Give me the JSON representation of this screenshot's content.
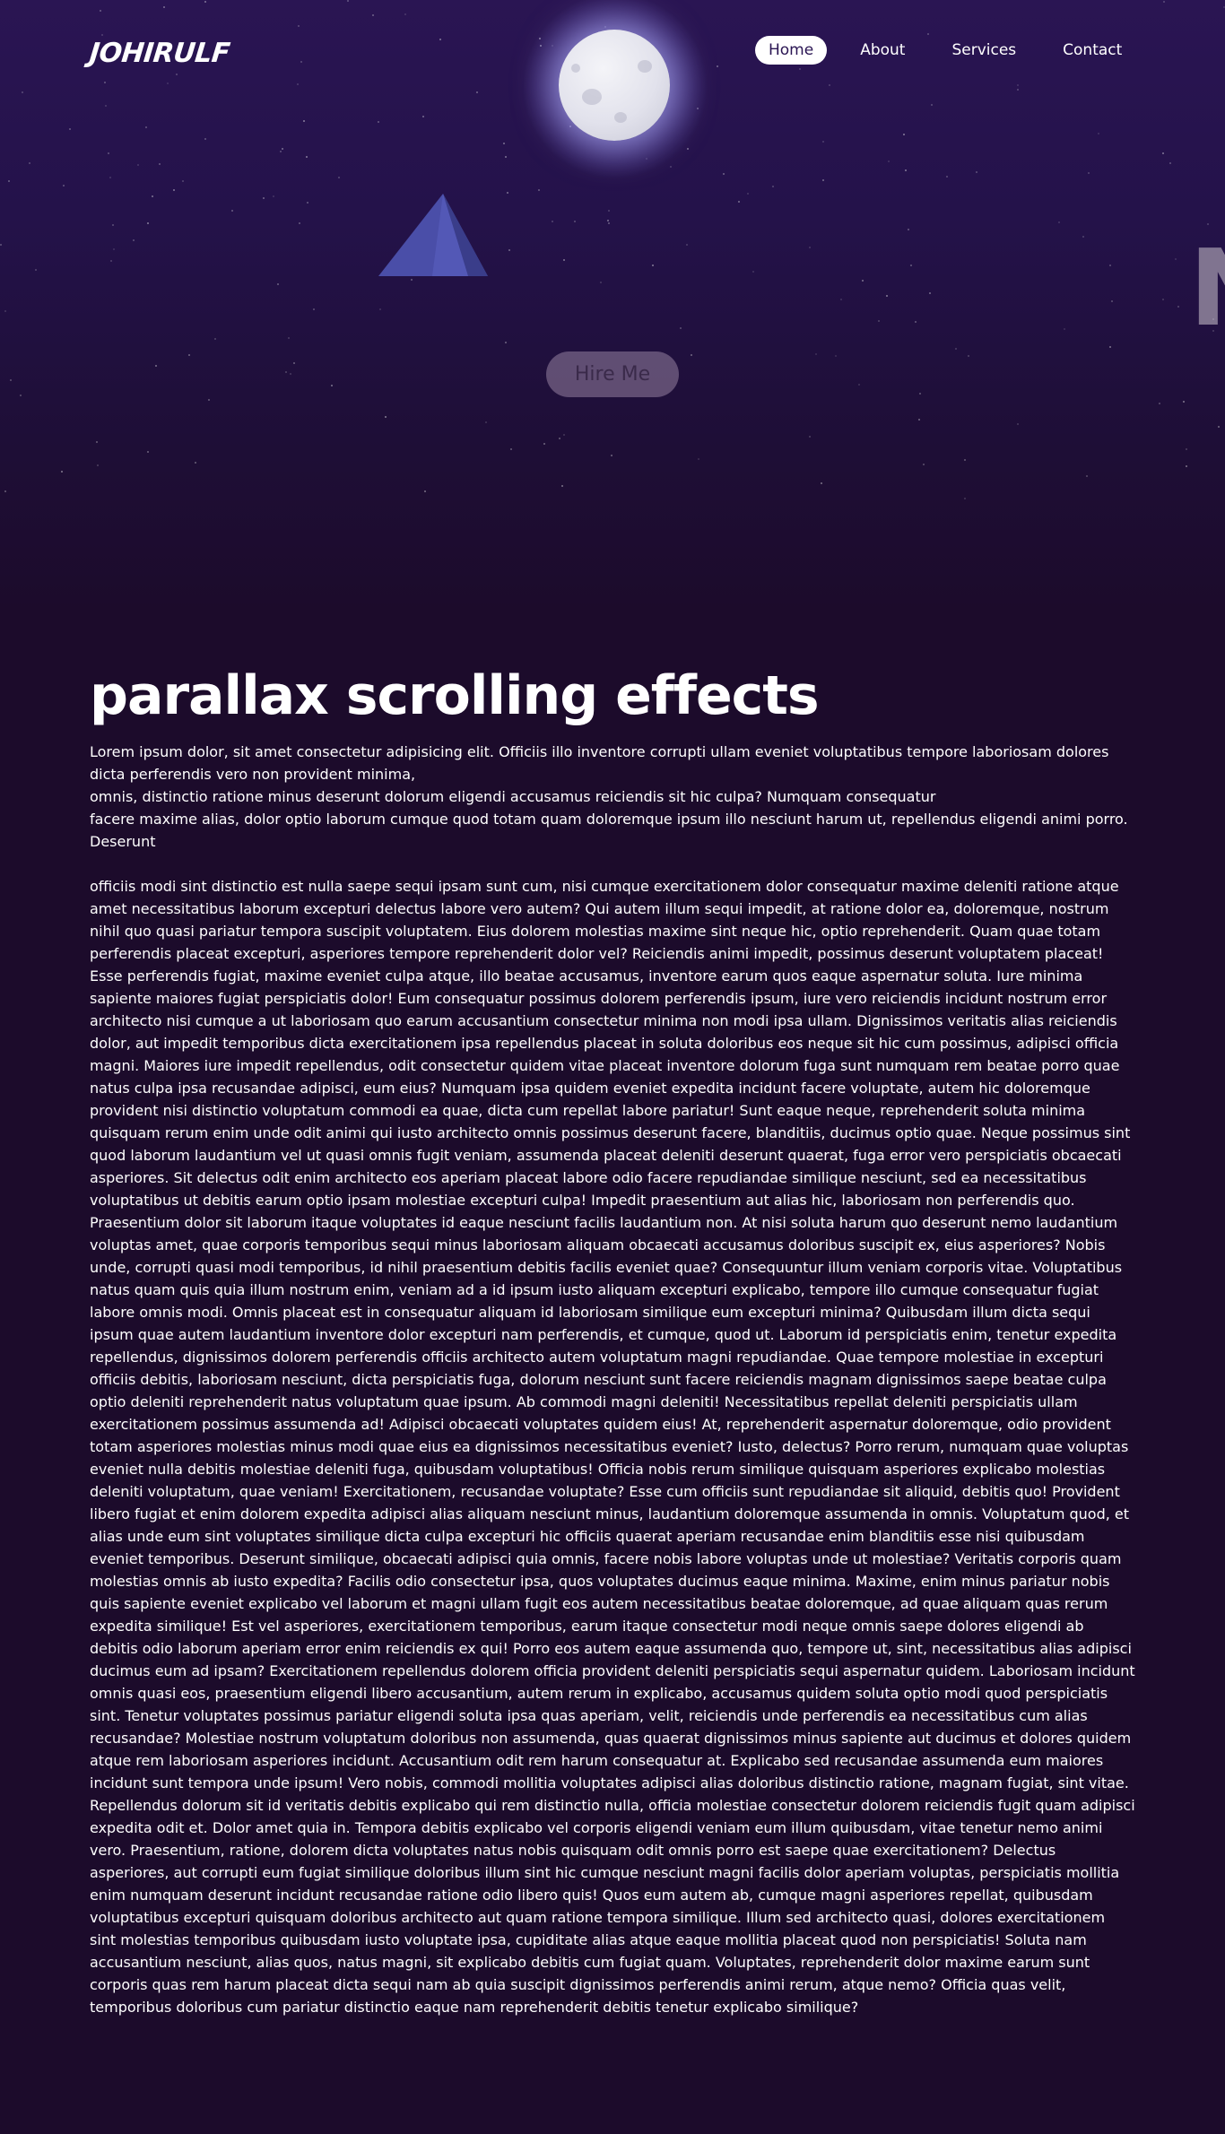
{
  "header": {
    "logo": "JOHIRULF",
    "nav": [
      {
        "label": "Home",
        "active": true
      },
      {
        "label": "About",
        "active": false
      },
      {
        "label": "Services",
        "active": false
      },
      {
        "label": "Contact",
        "active": false
      }
    ]
  },
  "hero": {
    "hire_button": "Hire Me",
    "side_letter": "N"
  },
  "main": {
    "title": "parallax scrolling effects",
    "intro_lines": [
      "Lorem ipsum dolor, sit amet consectetur adipisicing elit. Officiis illo inventore corrupti ullam eveniet voluptatibus tempore laboriosam dolores dicta perferendis vero non provident minima,",
      "omnis, distinctio ratione minus deserunt dolorum eligendi accusamus reiciendis sit hic culpa? Numquam consequatur",
      "facere maxime alias, dolor optio laborum cumque quod totam quam doloremque ipsum illo nesciunt harum ut, repellendus eligendi animi porro. Deserunt"
    ],
    "body_text": "officiis modi sint distinctio est nulla saepe sequi ipsam sunt cum, nisi cumque exercitationem dolor consequatur maxime deleniti ratione atque amet necessitatibus laborum excepturi delectus labore vero autem? Qui autem illum sequi impedit, at ratione dolor ea, doloremque, nostrum nihil quo quasi pariatur tempora suscipit voluptatem. Eius dolorem molestias maxime sint neque hic, optio reprehenderit. Quam quae totam perferendis placeat excepturi, asperiores tempore reprehenderit dolor vel? Reiciendis animi impedit, possimus deserunt voluptatem placeat! Esse perferendis fugiat, maxime eveniet culpa atque, illo beatae accusamus, inventore earum quos eaque aspernatur soluta. Iure minima sapiente maiores fugiat perspiciatis dolor! Eum consequatur possimus dolorem perferendis ipsum, iure vero reiciendis incidunt nostrum error architecto nisi cumque a ut laboriosam quo earum accusantium consectetur minima non modi ipsa ullam. Dignissimos veritatis alias reiciendis dolor, aut impedit temporibus dicta exercitationem ipsa repellendus placeat in soluta doloribus eos neque sit hic cum possimus, adipisci officia magni. Maiores iure impedit repellendus, odit consectetur quidem vitae placeat inventore dolorum fuga sunt numquam rem beatae porro quae natus culpa ipsa recusandae adipisci, eum eius? Numquam ipsa quidem eveniet expedita incidunt facere voluptate, autem hic doloremque provident nisi distinctio voluptatum commodi ea quae, dicta cum repellat labore pariatur! Sunt eaque neque, reprehenderit soluta minima quisquam rerum enim unde odit animi qui iusto architecto omnis possimus deserunt facere, blanditiis, ducimus optio quae. Neque possimus sint quod laborum laudantium vel ut quasi omnis fugit veniam, assumenda placeat deleniti deserunt quaerat, fuga error vero perspiciatis obcaecati asperiores. Sit delectus odit enim architecto eos aperiam placeat labore odio facere repudiandae similique nesciunt, sed ea necessitatibus voluptatibus ut debitis earum optio ipsam molestiae excepturi culpa! Impedit praesentium aut alias hic, laboriosam non perferendis quo. Praesentium dolor sit laborum itaque voluptates id eaque nesciunt facilis laudantium non. At nisi soluta harum quo deserunt nemo laudantium voluptas amet, quae corporis temporibus sequi minus laboriosam aliquam obcaecati accusamus doloribus suscipit ex, eius asperiores? Nobis unde, corrupti quasi modi temporibus, id nihil praesentium debitis facilis eveniet quae? Consequuntur illum veniam corporis vitae. Voluptatibus natus quam quis quia illum nostrum enim, veniam ad a id ipsum iusto aliquam excepturi explicabo, tempore illo cumque consequatur fugiat labore omnis modi. Omnis placeat est in consequatur aliquam id laboriosam similique eum excepturi minima? Quibusdam illum dicta sequi ipsum quae autem laudantium inventore dolor excepturi nam perferendis, et cumque, quod ut. Laborum id perspiciatis enim, tenetur expedita repellendus, dignissimos dolorem perferendis officiis architecto autem voluptatum magni repudiandae. Quae tempore molestiae in excepturi officiis debitis, laboriosam nesciunt, dicta perspiciatis fuga, dolorum nesciunt sunt facere reiciendis magnam dignissimos saepe beatae culpa optio deleniti reprehenderit natus voluptatum quae ipsum. Ab commodi magni deleniti! Necessitatibus repellat deleniti perspiciatis ullam exercitationem possimus assumenda ad! Adipisci obcaecati voluptates quidem eius! At, reprehenderit aspernatur doloremque, odio provident totam asperiores molestias minus modi quae eius ea dignissimos necessitatibus eveniet? Iusto, delectus? Porro rerum, numquam quae voluptas eveniet nulla debitis molestiae deleniti fuga, quibusdam voluptatibus! Officia nobis rerum similique quisquam asperiores explicabo molestias deleniti voluptatum, quae veniam! Exercitationem, recusandae voluptate? Esse cum officiis sunt repudiandae sit aliquid, debitis quo! Provident libero fugiat et enim dolorem expedita adipisci alias aliquam nesciunt minus, laudantium doloremque assumenda in omnis. Voluptatum quod, et alias unde eum sint voluptates similique dicta culpa excepturi hic officiis quaerat aperiam recusandae enim blanditiis esse nisi quibusdam eveniet temporibus. Deserunt similique, obcaecati adipisci quia omnis, facere nobis labore voluptas unde ut molestiae? Veritatis corporis quam molestias omnis ab iusto expedita? Facilis odio consectetur ipsa, quos voluptates ducimus eaque minima. Maxime, enim minus pariatur nobis quis sapiente eveniet explicabo vel laborum et magni ullam fugit eos autem necessitatibus beatae doloremque, ad quae aliquam quas rerum expedita similique! Est vel asperiores, exercitationem temporibus, earum itaque consectetur modi neque omnis saepe dolores eligendi ab debitis odio laborum aperiam error enim reiciendis ex qui! Porro eos autem eaque assumenda quo, tempore ut, sint, necessitatibus alias adipisci ducimus eum ad ipsam? Exercitationem repellendus dolorem officia provident deleniti perspiciatis sequi aspernatur quidem. Laboriosam incidunt omnis quasi eos, praesentium eligendi libero accusantium, autem rerum in explicabo, accusamus quidem soluta optio modi quod perspiciatis sint. Tenetur voluptates possimus pariatur eligendi soluta ipsa quas aperiam, velit, reiciendis unde perferendis ea necessitatibus cum alias recusandae? Molestiae nostrum voluptatum doloribus non assumenda, quas quaerat dignissimos minus sapiente aut ducimus et dolores quidem atque rem laboriosam asperiores incidunt. Accusantium odit rem harum consequatur at. Explicabo sed recusandae assumenda eum maiores incidunt sunt tempora unde ipsum! Vero nobis, commodi mollitia voluptates adipisci alias doloribus distinctio ratione, magnam fugiat, sint vitae. Repellendus dolorum sit id veritatis debitis explicabo qui rem distinctio nulla, officia molestiae consectetur dolorem reiciendis fugit quam adipisci expedita odit et. Dolor amet quia in. Tempora debitis explicabo vel corporis eligendi veniam eum illum quibusdam, vitae tenetur nemo animi vero. Praesentium, ratione, dolorem dicta voluptates natus nobis quisquam odit omnis porro est saepe quae exercitationem? Delectus asperiores, aut corrupti eum fugiat similique doloribus illum sint hic cumque nesciunt magni facilis dolor aperiam voluptas, perspiciatis mollitia enim numquam deserunt incidunt recusandae ratione odio libero quis! Quos eum autem ab, cumque magni asperiores repellat, quibusdam voluptatibus excepturi quisquam doloribus architecto aut quam ratione tempora similique. Illum sed architecto quasi, dolores exercitationem sint molestias temporibus quibusdam iusto voluptate ipsa, cupiditate alias atque eaque mollitia placeat quod non perspiciatis! Soluta nam accusantium nesciunt, alias quos, natus magni, sit explicabo debitis cum fugiat quam. Voluptates, reprehenderit dolor maxime earum sunt corporis quas rem harum placeat dicta sequi nam ab quia suscipit dignissimos perferendis animi rerum, atque nemo? Officia quas velit, temporibus doloribus cum pariatur distinctio eaque nam reprehenderit debitis tenetur explicabo similique?"
  }
}
